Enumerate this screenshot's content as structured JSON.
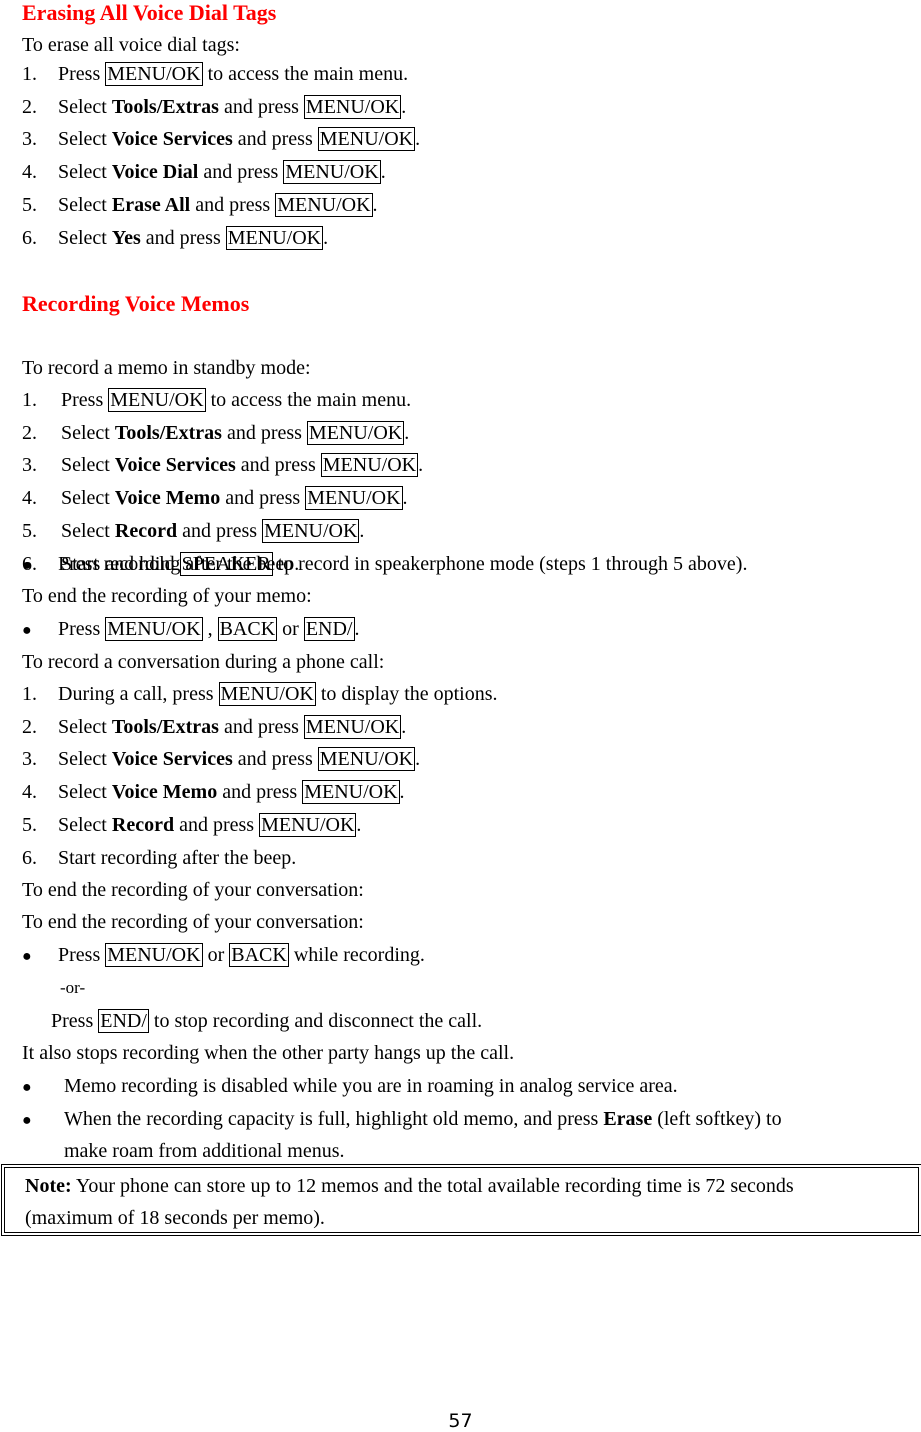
{
  "section1": {
    "title": "Erasing All Voice Dial Tags",
    "intro": "To erase all voice dial tags:",
    "steps": [
      {
        "num": "1.",
        "pre": "Press ",
        "bold": "",
        "mid": "",
        "key": "MENU/OK",
        "post": " to access the main menu."
      },
      {
        "num": "2.",
        "pre": "Select ",
        "bold": "Tools/Extras",
        "mid": " and press ",
        "key": "MENU/OK",
        "post": "."
      },
      {
        "num": "3.",
        "pre": "Select ",
        "bold": "Voice Services",
        "mid": " and press ",
        "key": "MENU/OK",
        "post": "."
      },
      {
        "num": "4.",
        "pre": "Select ",
        "bold": "Voice Dial",
        "mid": " and press ",
        "key": "MENU/OK",
        "post": "."
      },
      {
        "num": "5.",
        "pre": "Select ",
        "bold": "Erase All",
        "mid": " and press ",
        "key": "MENU/OK",
        "post": "."
      },
      {
        "num": "6.",
        "pre": "Select ",
        "bold": "Yes",
        "mid": " and press ",
        "key": "MENU/OK",
        "post": "."
      }
    ]
  },
  "section2": {
    "title": "Recording Voice Memos",
    "intro": "To record a memo in standby mode:",
    "steps": [
      {
        "num": "1.",
        "pre": "Press ",
        "bold": "",
        "mid": "",
        "key": "MENU/OK",
        "post": " to access the main menu."
      },
      {
        "num": "2.",
        "pre": "Select ",
        "bold": "Tools/Extras",
        "mid": " and press ",
        "key": "MENU/OK",
        "post": "."
      },
      {
        "num": "3.",
        "pre": "Select ",
        "bold": "Voice Services",
        "mid": " and press ",
        "key": "MENU/OK",
        "post": "."
      },
      {
        "num": "4.",
        "pre": "Select ",
        "bold": "Voice Memo",
        "mid": " and press ",
        "key": "MENU/OK",
        "post": "."
      },
      {
        "num": "5.",
        "pre": "Select ",
        "bold": "Record",
        "mid": " and press ",
        "key": "MENU/OK",
        "post": "."
      },
      {
        "num": "6.",
        "text": "Start recording after the beep."
      }
    ],
    "speaker_bullet": {
      "pre": "Press and hold ",
      "key": "SPEAKER",
      "post": " to record in speakerphone mode (steps 1 through 5 above)."
    },
    "end_memo_intro": "To end the recording of your memo:",
    "end_memo_bullet": {
      "pre": "Press ",
      "key1": "MENU/OK",
      "sep1": " , ",
      "key2": "BACK",
      "sep2": " or ",
      "key3": "END/",
      "post": "."
    },
    "call_intro": "To record a conversation during a phone call:",
    "call_steps": [
      {
        "num": "1.",
        "pre": "During a call, press ",
        "bold": "",
        "mid": "",
        "key": "MENU/OK",
        "post": " to display the options."
      },
      {
        "num": "2.",
        "pre": "Select ",
        "bold": "Tools/Extras",
        "mid": " and press ",
        "key": "MENU/OK",
        "post": "."
      },
      {
        "num": "3.",
        "pre": "Select ",
        "bold": "Voice Services",
        "mid": " and press ",
        "key": "MENU/OK",
        "post": "."
      },
      {
        "num": "4.",
        "pre": "Select ",
        "bold": "Voice Memo",
        "mid": " and press ",
        "key": "MENU/OK",
        "post": "."
      },
      {
        "num": "5.",
        "pre": "Select ",
        "bold": "Record",
        "mid": " and press ",
        "key": "MENU/OK",
        "post": "."
      },
      {
        "num": "6.",
        "text": "Start recording after the beep."
      }
    ],
    "end_conv_intro_1": "To end the recording of your conversation:",
    "end_conv_intro_2": "To end the recording of your conversation:",
    "end_conv_bullet": {
      "pre": "Press ",
      "key1": "MENU/OK",
      "sep1": " or ",
      "key2": "BACK",
      "post": " while recording."
    },
    "or_text": "-or-",
    "end_press": {
      "pre": "Press ",
      "key": "END/",
      "post": " to stop recording and disconnect the call."
    },
    "hangup_text": "It also stops recording when the other party hangs up the call.",
    "roaming_bullet": "Memo recording is disabled while you are in roaming in analog service area.",
    "capacity_bullet": {
      "pre": "When the recording capacity is full, highlight old memo, and press ",
      "bold": "Erase",
      "post": " (left softkey) to",
      "line2": "make roam from additional menus."
    }
  },
  "note": {
    "label": "Note:",
    "line1": " Your phone can store up to 12 memos and the total available recording time is 72 seconds",
    "line2": "(maximum of 18 seconds per memo)."
  },
  "page_number": "57",
  "colors": {
    "heading": "#ff0000",
    "text": "#000000"
  }
}
